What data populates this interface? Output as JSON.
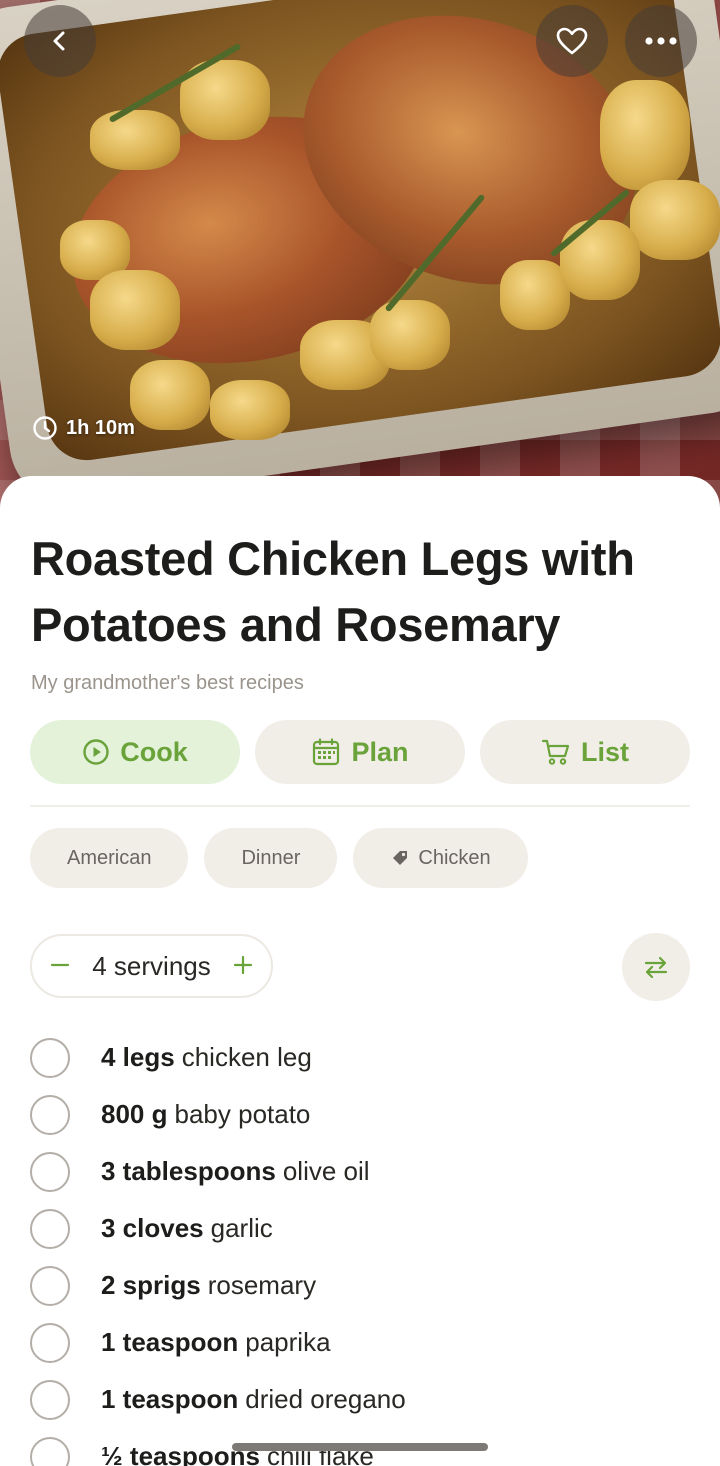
{
  "hero": {
    "cook_time": "1h 10m"
  },
  "recipe": {
    "title": "Roasted Chicken Legs with Potatoes and Rosemary",
    "collection": "My grandmother's best recipes"
  },
  "actions": {
    "cook": "Cook",
    "plan": "Plan",
    "list": "List"
  },
  "tags": [
    "American",
    "Dinner",
    "Chicken"
  ],
  "servings": {
    "label": "4 servings"
  },
  "ingredients": [
    {
      "qty": "4 legs",
      "name": "chicken leg"
    },
    {
      "qty": "800 g",
      "name": "baby potato"
    },
    {
      "qty": "3 tablespoons",
      "name": "olive oil"
    },
    {
      "qty": "3 cloves",
      "name": "garlic"
    },
    {
      "qty": "2 sprigs",
      "name": "rosemary"
    },
    {
      "qty": "1 teaspoon",
      "name": "paprika"
    },
    {
      "qty": "1 teaspoon",
      "name": "dried oregano"
    },
    {
      "qty": "½ teaspoons",
      "name": "chili flake"
    }
  ],
  "colors": {
    "accent": "#6aa33a",
    "chip_bg": "#f1eee8",
    "primary_bg": "#e4f2da"
  }
}
